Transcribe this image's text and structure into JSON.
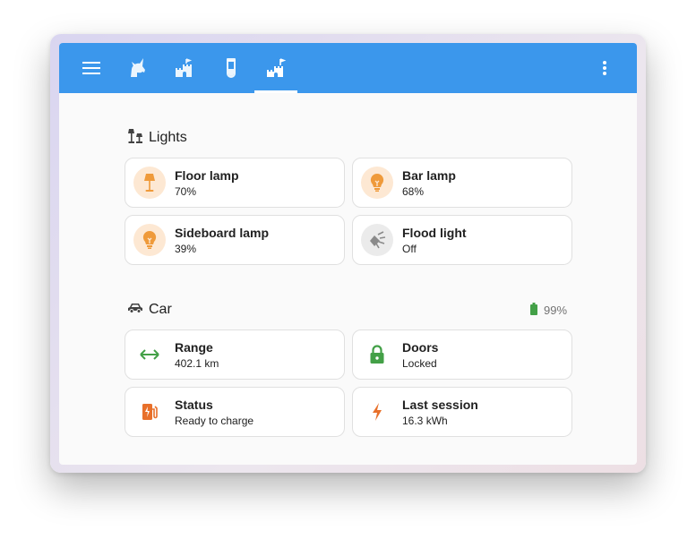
{
  "topbar": {
    "menu_icon": "menu-icon",
    "tabs": [
      {
        "icon": "unicorn-icon",
        "active": false
      },
      {
        "icon": "castle-icon",
        "active": false
      },
      {
        "icon": "test-tube-icon",
        "active": false
      },
      {
        "icon": "castle-flag-icon",
        "active": true
      }
    ],
    "overflow_icon": "dots-vertical-icon",
    "color": "#3b97ec"
  },
  "lights": {
    "title": "Lights",
    "icon": "lamps-icon",
    "items": [
      {
        "name": "Floor lamp",
        "state": "70%",
        "icon": "floor-lamp-icon",
        "color": "#ef9a3a"
      },
      {
        "name": "Bar lamp",
        "state": "68%",
        "icon": "lightbulb-icon",
        "color": "#ef9a3a"
      },
      {
        "name": "Sideboard lamp",
        "state": "39%",
        "icon": "lightbulb-icon",
        "color": "#ef9a3a"
      },
      {
        "name": "Flood light",
        "state": "Off",
        "icon": "spotlight-beam-icon",
        "color": "#8a8a8a"
      }
    ]
  },
  "car": {
    "title": "Car",
    "icon": "car-icon",
    "battery": "99%",
    "battery_color": "#43a047",
    "items": [
      {
        "name": "Range",
        "state": "402.1 km",
        "icon": "arrow-left-right-icon",
        "color": "#43a047"
      },
      {
        "name": "Doors",
        "state": "Locked",
        "icon": "lock-icon",
        "color": "#43a047"
      },
      {
        "name": "Status",
        "state": "Ready to charge",
        "icon": "ev-station-icon",
        "color": "#e8702a"
      },
      {
        "name": "Last session",
        "state": "16.3 kWh",
        "icon": "lightning-bolt-icon",
        "color": "#e8702a"
      }
    ]
  }
}
